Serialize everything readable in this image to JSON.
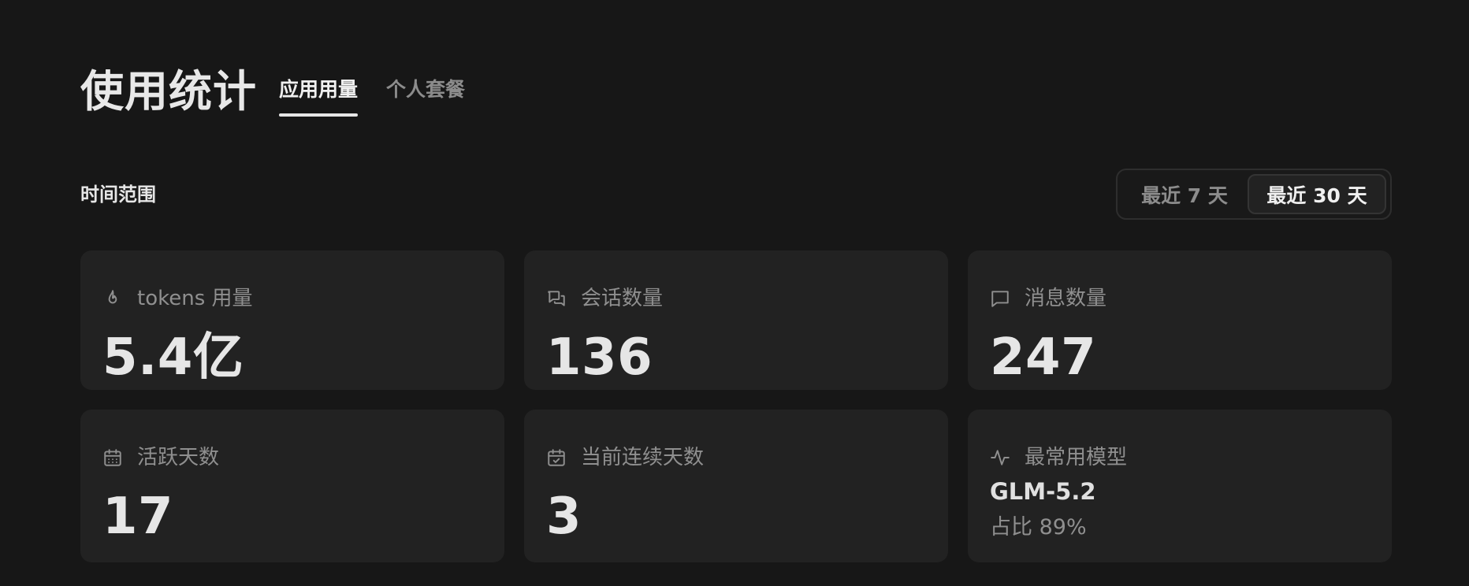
{
  "header": {
    "title": "使用统计",
    "tabs": [
      {
        "label": "应用用量",
        "active": true
      },
      {
        "label": "个人套餐",
        "active": false
      }
    ]
  },
  "range": {
    "label": "时间范围",
    "options": [
      {
        "label": "最近 7 天",
        "selected": false
      },
      {
        "label": "最近 30 天",
        "selected": true
      }
    ]
  },
  "cards": [
    {
      "label": "tokens 用量",
      "value": "5.4亿",
      "icon": "flame-icon"
    },
    {
      "label": "会话数量",
      "value": "136",
      "icon": "chat-bubbles-icon"
    },
    {
      "label": "消息数量",
      "value": "247",
      "icon": "message-icon"
    },
    {
      "label": "活跃天数",
      "value": "17",
      "icon": "calendar-grid-icon"
    },
    {
      "label": "当前连续天数",
      "value": "3",
      "icon": "calendar-check-icon"
    },
    {
      "label": "最常用模型",
      "model": "GLM-5.2",
      "share": "占比 89%",
      "icon": "activity-icon"
    }
  ],
  "colors": {
    "background": "#171717",
    "card": "#222222",
    "text": "#e6e6e6",
    "muted": "#8f8f8f"
  }
}
